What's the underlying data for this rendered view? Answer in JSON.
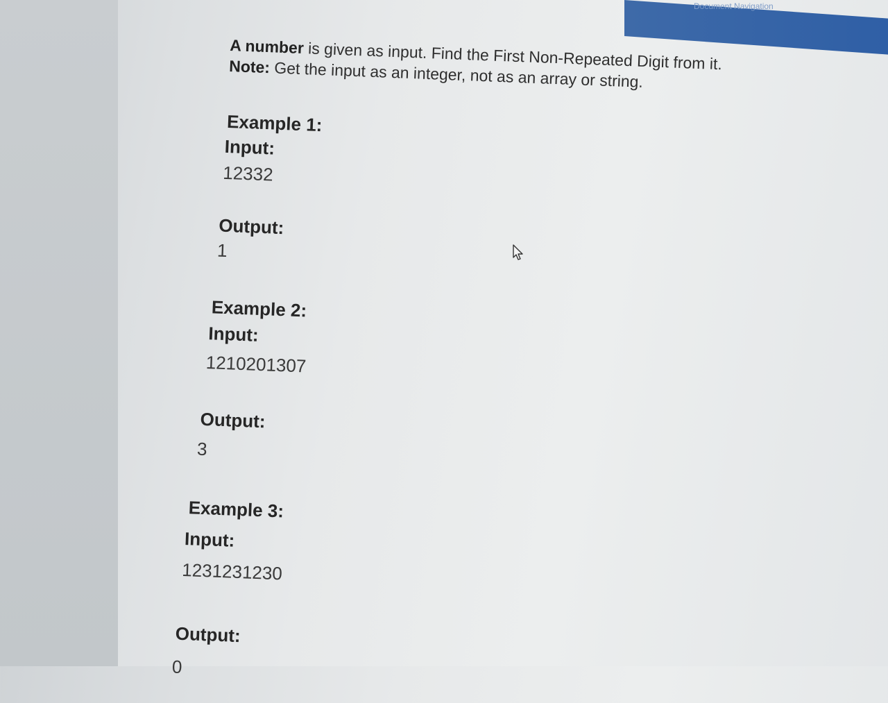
{
  "window": {
    "nav_label": "Document Navigation"
  },
  "problem": {
    "intro_bold": "A number",
    "intro_rest": " is given as input. Find the First Non-Repeated Digit from it.",
    "note_bold": "Note:",
    "note_rest": " Get the input as an integer, not as an array or string."
  },
  "examples": [
    {
      "title": "Example 1:",
      "input_label": "Input:",
      "input_value": "12332",
      "output_label": "Output:",
      "output_value": "1"
    },
    {
      "title": "Example 2:",
      "input_label": "Input:",
      "input_value": "1210201307",
      "output_label": "Output:",
      "output_value": "3"
    },
    {
      "title": "Example 3:",
      "input_label": "Input:",
      "input_value": "1231231230",
      "output_label": "Output:",
      "output_value": "0"
    }
  ],
  "colors": {
    "background": "#e7e9ea",
    "text": "#2b2b2b",
    "nav_bar": "#2f5fa6"
  },
  "icons": {
    "cursor": "mouse-pointer-icon"
  }
}
